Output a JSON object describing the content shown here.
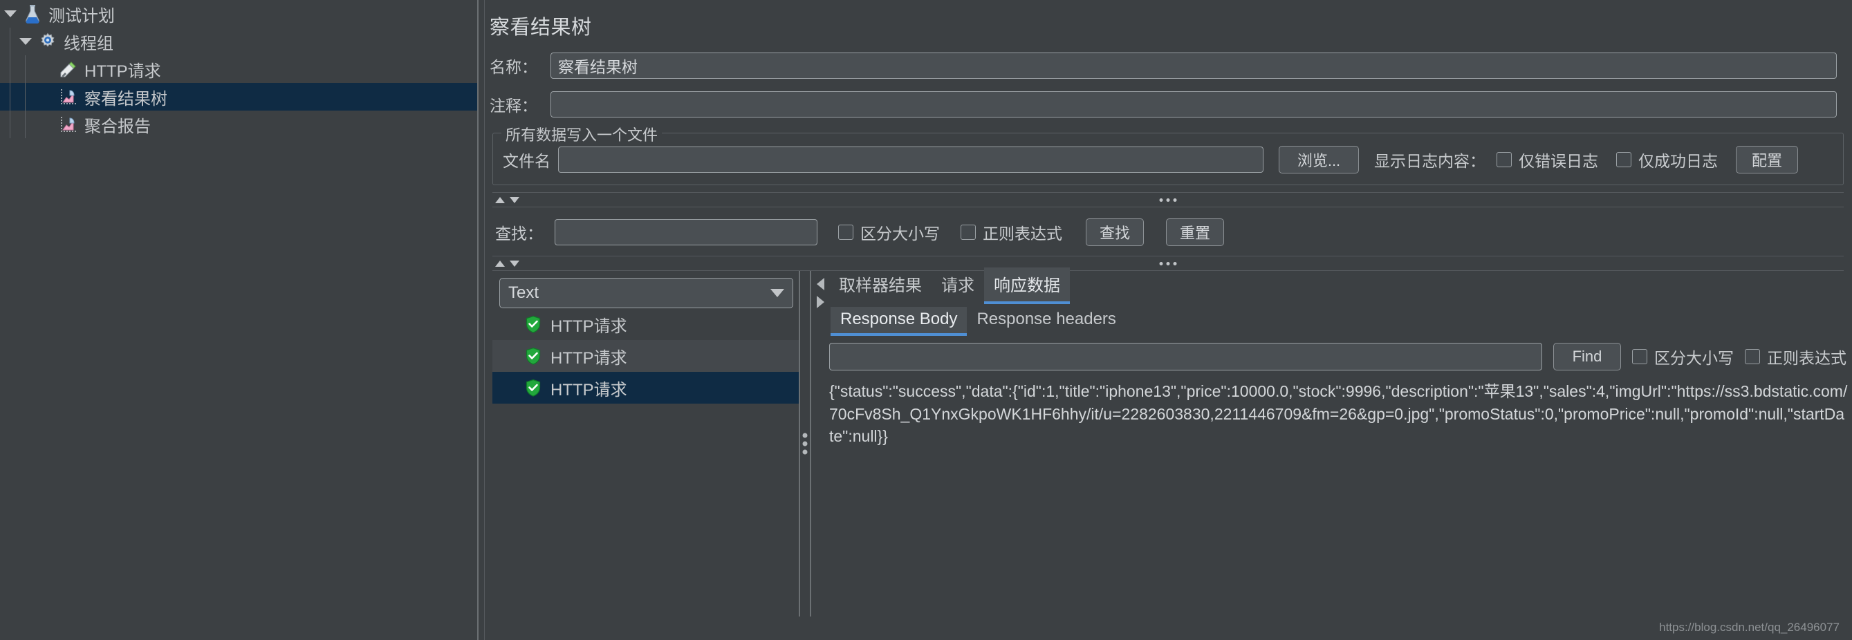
{
  "tree": {
    "items": [
      {
        "label": "测试计划",
        "icon": "flask-icon",
        "depth": 0,
        "expanded": true,
        "selected": false
      },
      {
        "label": "线程组",
        "icon": "gear-icon",
        "depth": 1,
        "expanded": true,
        "selected": false
      },
      {
        "label": "HTTP请求",
        "icon": "pipette-icon",
        "depth": 2,
        "expanded": false,
        "selected": false
      },
      {
        "label": "察看结果树",
        "icon": "chart-icon",
        "depth": 2,
        "expanded": false,
        "selected": true
      },
      {
        "label": "聚合报告",
        "icon": "chart-icon",
        "depth": 2,
        "expanded": false,
        "selected": false
      }
    ]
  },
  "panel": {
    "title": "察看结果树",
    "name_label": "名称：",
    "name_value": "察看结果树",
    "comment_label": "注释：",
    "comment_value": "",
    "filegroup": {
      "legend": "所有数据写入一个文件",
      "file_label": "文件名",
      "file_value": "",
      "browse_label": "浏览...",
      "log_content_label": "显示日志内容：",
      "errors_only_label": "仅错误日志",
      "errors_only_checked": false,
      "success_only_label": "仅成功日志",
      "success_only_checked": false,
      "configure_label": "配置"
    },
    "search": {
      "label": "查找：",
      "value": "",
      "case_sensitive_label": "区分大小写",
      "case_sensitive_checked": false,
      "regex_label": "正则表达式",
      "regex_checked": false,
      "find_button": "查找",
      "reset_button": "重置"
    }
  },
  "results": {
    "render_selector": "Text",
    "rows": [
      {
        "label": "HTTP请求",
        "icon": "green-shield-check-icon",
        "selected": false
      },
      {
        "label": "HTTP请求",
        "icon": "green-shield-check-icon",
        "selected": false
      },
      {
        "label": "HTTP请求",
        "icon": "green-shield-check-icon",
        "selected": true
      }
    ]
  },
  "detail": {
    "tabs": [
      {
        "label": "取样器结果",
        "active": false
      },
      {
        "label": "请求",
        "active": false
      },
      {
        "label": "响应数据",
        "active": true
      }
    ],
    "subtabs": [
      {
        "label": "Response Body",
        "active": true
      },
      {
        "label": "Response headers",
        "active": false
      }
    ],
    "find": {
      "value": "",
      "find_button": "Find",
      "case_sensitive_label": "区分大小写",
      "case_sensitive_checked": false,
      "regex_label": "正则表达式",
      "regex_checked": false
    },
    "body": "{\"status\":\"success\",\"data\":{\"id\":1,\"title\":\"iphone13\",\"price\":10000.0,\"stock\":9996,\"description\":\"苹果13\",\"sales\":4,\"imgUrl\":\"https://ss3.bdstatic.com/70cFv8Sh_Q1YnxGkpoWK1HF6hhy/it/u=2282603830,2211446709&fm=26&gp=0.jpg\",\"promoStatus\":0,\"promoPrice\":null,\"promoId\":null,\"startDate\":null}}"
  },
  "watermark": "https://blog.csdn.net/qq_26496077",
  "colors": {
    "background": "#3c4043",
    "selection": "#0f2b44",
    "accent": "#4f8fd4",
    "field": "#4a4f53",
    "border": "#9aa0a4",
    "text": "#c6c9cc",
    "success": "#22a83c"
  }
}
